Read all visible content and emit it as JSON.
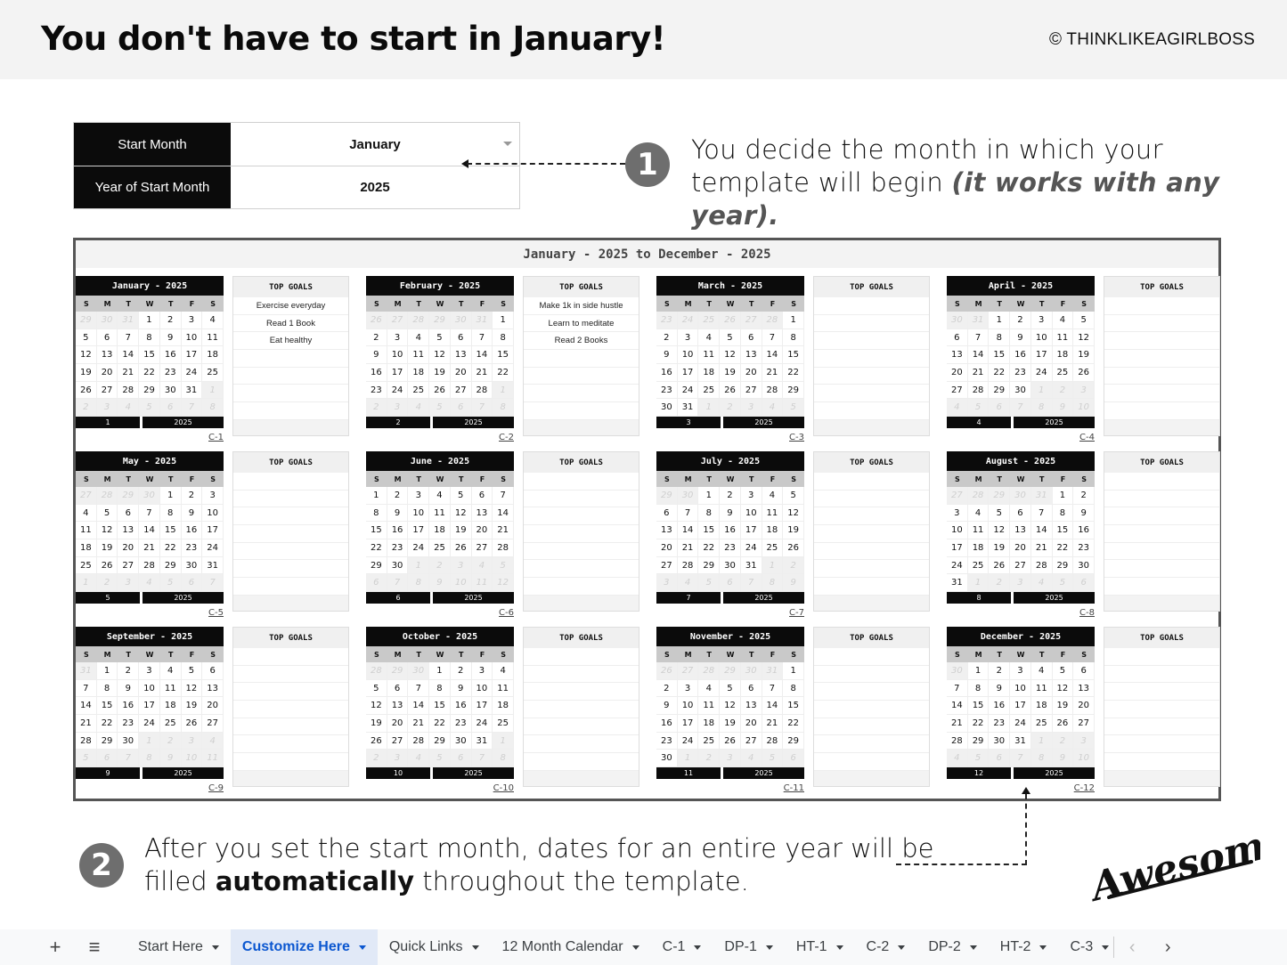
{
  "header": {
    "title": "You don't have to start in January!",
    "copyright": "© THINKLIKEAGIRLBOSS"
  },
  "settings": {
    "start_month_label": "Start Month",
    "start_month_value": "January",
    "year_label": "Year of Start Month",
    "year_value": "2025"
  },
  "callouts": {
    "step1_number": "1",
    "step1_line1": "You decide the month in which your",
    "step1_line2_plain": "template will begin ",
    "step1_line2_emphasis": "(it works with any year).",
    "step2_number": "2",
    "step2_line1": "After you set the start month, dates for an entire year will be",
    "step2_line2_pre": "filled ",
    "step2_line2_bold": "automatically",
    "step2_line2_post": " throughout the template.",
    "signature": "Awesome"
  },
  "panel": {
    "header": "January - 2025 to December - 2025",
    "weekdays": [
      "S",
      "M",
      "T",
      "W",
      "T",
      "F",
      "S"
    ],
    "goals_title": "TOP GOALS",
    "months": [
      {
        "title": "January - 2025",
        "number": "1",
        "year": "2025",
        "link": "C-1",
        "first_in": 3,
        "last_in": 33,
        "days": [
          29,
          30,
          31,
          1,
          2,
          3,
          4,
          5,
          6,
          7,
          8,
          9,
          10,
          11,
          12,
          13,
          14,
          15,
          16,
          17,
          18,
          19,
          20,
          21,
          22,
          23,
          24,
          25,
          26,
          27,
          28,
          29,
          30,
          31,
          1,
          2,
          3,
          4,
          5,
          6,
          7,
          8
        ],
        "goals": [
          "Exercise everyday",
          "Read 1 Book",
          "Eat healthy",
          "",
          "",
          "",
          ""
        ]
      },
      {
        "title": "February - 2025",
        "number": "2",
        "year": "2025",
        "link": "C-2",
        "first_in": 6,
        "last_in": 33,
        "days": [
          26,
          27,
          28,
          29,
          30,
          31,
          1,
          2,
          3,
          4,
          5,
          6,
          7,
          8,
          9,
          10,
          11,
          12,
          13,
          14,
          15,
          16,
          17,
          18,
          19,
          20,
          21,
          22,
          23,
          24,
          25,
          26,
          27,
          28,
          1,
          2,
          3,
          4,
          5,
          6,
          7,
          8
        ],
        "goals": [
          "Make 1k in side hustle",
          "Learn to meditate",
          "Read 2 Books",
          "",
          "",
          "",
          ""
        ]
      },
      {
        "title": "March - 2025",
        "number": "3",
        "year": "2025",
        "link": "C-3",
        "first_in": 6,
        "last_in": 36,
        "days": [
          23,
          24,
          25,
          26,
          27,
          28,
          1,
          2,
          3,
          4,
          5,
          6,
          7,
          8,
          9,
          10,
          11,
          12,
          13,
          14,
          15,
          16,
          17,
          18,
          19,
          20,
          21,
          22,
          23,
          24,
          25,
          26,
          27,
          28,
          29,
          30,
          31,
          1,
          2,
          3,
          4,
          5
        ],
        "goals": [
          "",
          "",
          "",
          "",
          "",
          "",
          ""
        ]
      },
      {
        "title": "April - 2025",
        "number": "4",
        "year": "2025",
        "link": "C-4",
        "first_in": 2,
        "last_in": 31,
        "days": [
          30,
          31,
          1,
          2,
          3,
          4,
          5,
          6,
          7,
          8,
          9,
          10,
          11,
          12,
          13,
          14,
          15,
          16,
          17,
          18,
          19,
          20,
          21,
          22,
          23,
          24,
          25,
          26,
          27,
          28,
          29,
          30,
          1,
          2,
          3,
          4,
          5,
          6,
          7,
          8,
          9,
          10
        ],
        "goals": [
          "",
          "",
          "",
          "",
          "",
          "",
          ""
        ]
      },
      {
        "title": "May - 2025",
        "number": "5",
        "year": "2025",
        "link": "C-5",
        "first_in": 4,
        "last_in": 34,
        "days": [
          27,
          28,
          29,
          30,
          1,
          2,
          3,
          4,
          5,
          6,
          7,
          8,
          9,
          10,
          11,
          12,
          13,
          14,
          15,
          16,
          17,
          18,
          19,
          20,
          21,
          22,
          23,
          24,
          25,
          26,
          27,
          28,
          29,
          30,
          31,
          1,
          2,
          3,
          4,
          5,
          6,
          7
        ],
        "goals": [
          "",
          "",
          "",
          "",
          "",
          "",
          ""
        ]
      },
      {
        "title": "June - 2025",
        "number": "6",
        "year": "2025",
        "link": "C-6",
        "first_in": 0,
        "last_in": 29,
        "days": [
          1,
          2,
          3,
          4,
          5,
          6,
          7,
          8,
          9,
          10,
          11,
          12,
          13,
          14,
          15,
          16,
          17,
          18,
          19,
          20,
          21,
          22,
          23,
          24,
          25,
          26,
          27,
          28,
          29,
          30,
          1,
          2,
          3,
          4,
          5,
          6,
          7,
          8,
          9,
          10,
          11,
          12
        ],
        "goals": [
          "",
          "",
          "",
          "",
          "",
          "",
          ""
        ]
      },
      {
        "title": "July - 2025",
        "number": "7",
        "year": "2025",
        "link": "C-7",
        "first_in": 2,
        "last_in": 32,
        "days": [
          29,
          30,
          1,
          2,
          3,
          4,
          5,
          6,
          7,
          8,
          9,
          10,
          11,
          12,
          13,
          14,
          15,
          16,
          17,
          18,
          19,
          20,
          21,
          22,
          23,
          24,
          25,
          26,
          27,
          28,
          29,
          30,
          31,
          1,
          2,
          3,
          4,
          5,
          6,
          7,
          8,
          9
        ],
        "goals": [
          "",
          "",
          "",
          "",
          "",
          "",
          ""
        ]
      },
      {
        "title": "August - 2025",
        "number": "8",
        "year": "2025",
        "link": "C-8",
        "first_in": 5,
        "last_in": 35,
        "days": [
          27,
          28,
          29,
          30,
          31,
          1,
          2,
          3,
          4,
          5,
          6,
          7,
          8,
          9,
          10,
          11,
          12,
          13,
          14,
          15,
          16,
          17,
          18,
          19,
          20,
          21,
          22,
          23,
          24,
          25,
          26,
          27,
          28,
          29,
          30,
          31,
          1,
          2,
          3,
          4,
          5,
          6
        ],
        "goals": [
          "",
          "",
          "",
          "",
          "",
          "",
          ""
        ]
      },
      {
        "title": "September - 2025",
        "number": "9",
        "year": "2025",
        "link": "C-9",
        "first_in": 1,
        "last_in": 30,
        "days": [
          31,
          1,
          2,
          3,
          4,
          5,
          6,
          7,
          8,
          9,
          10,
          11,
          12,
          13,
          14,
          15,
          16,
          17,
          18,
          19,
          20,
          21,
          22,
          23,
          24,
          25,
          26,
          27,
          28,
          29,
          30,
          1,
          2,
          3,
          4,
          5,
          6,
          7,
          8,
          9,
          10,
          11
        ],
        "goals": [
          "",
          "",
          "",
          "",
          "",
          "",
          ""
        ]
      },
      {
        "title": "October - 2025",
        "number": "10",
        "year": "2025",
        "link": "C-10",
        "first_in": 3,
        "last_in": 33,
        "days": [
          28,
          29,
          30,
          1,
          2,
          3,
          4,
          5,
          6,
          7,
          8,
          9,
          10,
          11,
          12,
          13,
          14,
          15,
          16,
          17,
          18,
          19,
          20,
          21,
          22,
          23,
          24,
          25,
          26,
          27,
          28,
          29,
          30,
          31,
          1,
          2,
          3,
          4,
          5,
          6,
          7,
          8
        ],
        "goals": [
          "",
          "",
          "",
          "",
          "",
          "",
          ""
        ]
      },
      {
        "title": "November - 2025",
        "number": "11",
        "year": "2025",
        "link": "C-11",
        "first_in": 6,
        "last_in": 35,
        "days": [
          26,
          27,
          28,
          29,
          30,
          31,
          1,
          2,
          3,
          4,
          5,
          6,
          7,
          8,
          9,
          10,
          11,
          12,
          13,
          14,
          15,
          16,
          17,
          18,
          19,
          20,
          21,
          22,
          23,
          24,
          25,
          26,
          27,
          28,
          29,
          30,
          1,
          2,
          3,
          4,
          5,
          6
        ],
        "goals": [
          "",
          "",
          "",
          "",
          "",
          "",
          ""
        ]
      },
      {
        "title": "December - 2025",
        "number": "12",
        "year": "2025",
        "link": "C-12",
        "first_in": 1,
        "last_in": 31,
        "days": [
          30,
          1,
          2,
          3,
          4,
          5,
          6,
          7,
          8,
          9,
          10,
          11,
          12,
          13,
          14,
          15,
          16,
          17,
          18,
          19,
          20,
          21,
          22,
          23,
          24,
          25,
          26,
          27,
          28,
          29,
          30,
          31,
          1,
          2,
          3,
          4,
          5,
          6,
          7,
          8,
          9,
          10
        ],
        "goals": [
          "",
          "",
          "",
          "",
          "",
          "",
          ""
        ]
      }
    ]
  },
  "tabbar": {
    "add_icon": "+",
    "menu_icon": "≡",
    "tabs": [
      {
        "label": "Start Here",
        "active": false
      },
      {
        "label": "Customize Here",
        "active": true
      },
      {
        "label": "Quick Links",
        "active": false
      },
      {
        "label": "12 Month Calendar",
        "active": false
      },
      {
        "label": "C-1",
        "active": false
      },
      {
        "label": "DP-1",
        "active": false
      },
      {
        "label": "HT-1",
        "active": false
      },
      {
        "label": "C-2",
        "active": false
      },
      {
        "label": "DP-2",
        "active": false
      },
      {
        "label": "HT-2",
        "active": false
      },
      {
        "label": "C-3",
        "active": false
      }
    ],
    "prev_icon": "‹",
    "next_icon": "›",
    "active_color": "#0b57d0"
  }
}
